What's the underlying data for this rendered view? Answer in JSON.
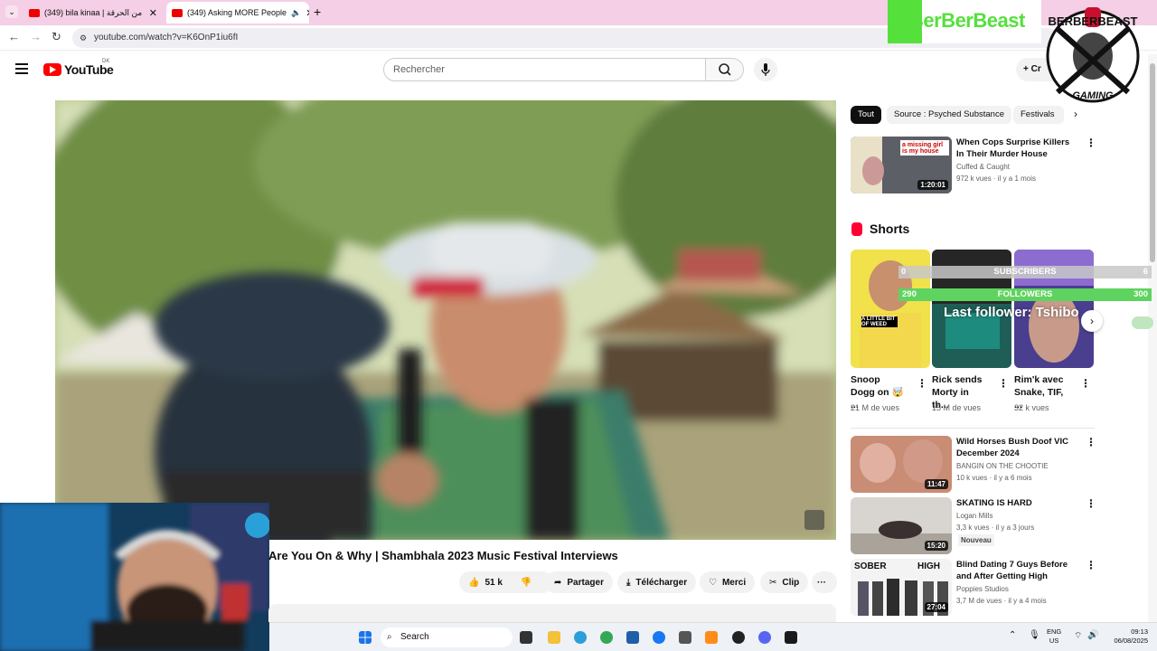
{
  "tabs": [
    {
      "label": "(349) bila kinaa | مكي من الحرقة"
    },
    {
      "label": "(349) Asking MORE People"
    }
  ],
  "address": {
    "url": "youtube.com/watch?v=K6OnP1iu6fI"
  },
  "youtube": {
    "logo_text": "YouTube",
    "region": "DK",
    "search_placeholder": "Rechercher",
    "create_label": "Cr"
  },
  "video": {
    "title": "Are You On & Why | Shambhala 2023 Music Festival Interviews"
  },
  "actions": {
    "likes": "51 k",
    "share": "Partager",
    "download": "Télécharger",
    "thanks": "Merci",
    "clip": "Clip",
    "more": "···"
  },
  "chips": [
    "Tout",
    "Source : Psyched Substance",
    "Festivals"
  ],
  "recommended_top": {
    "title": "When Cops Surprise Killers In Their Murder House",
    "channel": "Cuffed & Caught",
    "meta": "972 k vues · il y a 1 mois",
    "duration": "1:20:01",
    "thumb_caption": "a missing girl is my house"
  },
  "shorts": {
    "heading": "Shorts",
    "items": [
      {
        "title": "Snoop Dogg on 🤯 ...",
        "views": "21 M de vues",
        "caption": "A LITTLE BIT OF WEED"
      },
      {
        "title": "Rick sends Morty in th...",
        "views": "15 M de vues"
      },
      {
        "title": "Rim'k avec Snake, TIF, ...",
        "views": "32 k vues"
      }
    ]
  },
  "recommended": [
    {
      "title": "Wild Horses Bush Doof VIC December 2024",
      "channel": "BANGIN ON THE CHOOTIE",
      "meta": "10 k vues · il y a 6 mois",
      "duration": "11:47"
    },
    {
      "title": "SKATING IS HARD",
      "channel": "Logan Mills",
      "meta": "3,3 k vues · il y a 3 jours",
      "badge": "Nouveau",
      "duration": "15:20"
    },
    {
      "title": "Blind Dating 7 Guys Before and After Getting High",
      "channel": "Poppies Studios",
      "meta": "3,7 M de vues · il y a 4 mois",
      "duration": "27:04",
      "thumb_caption_left": "SOBER",
      "thumb_caption_right": "HIGH"
    }
  ],
  "overlay": {
    "brand": "BerBerBeast",
    "badge_top": "BERBERBEAST",
    "badge_bottom": "GAMING",
    "subscribers_label": "SUBSCRIBERS",
    "subscribers_left": "0",
    "subscribers_right": "6",
    "followers_label": "FOLLOWERS",
    "followers_left": "290",
    "followers_right": "300",
    "last_follower": "Last follower: Tshibo"
  },
  "taskbar": {
    "search": "Search",
    "lang": "ENG",
    "region": "US",
    "time": "09:13",
    "date": "06/08/2025"
  },
  "colors": {
    "accent_red": "#ff0000",
    "overlay_green": "#5fd35f",
    "tab_strip": "#f4cfe6"
  }
}
